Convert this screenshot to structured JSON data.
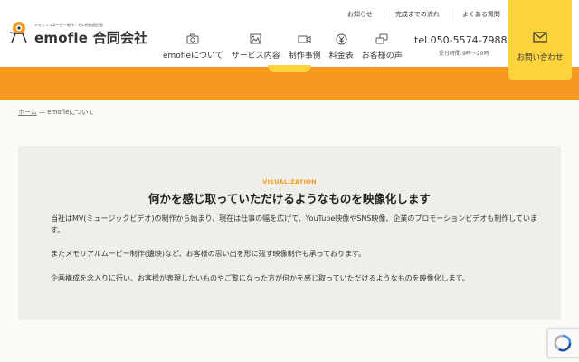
{
  "header": {
    "logo_tagline": "メモリアルムービー制作｜その他動画企画",
    "logo_name": "emofle 合同会社",
    "top_links": [
      "お知らせ",
      "完成までの流れ",
      "よくある質問"
    ],
    "main_nav": [
      {
        "label": "emofleについて",
        "icon": "camera-icon"
      },
      {
        "label": "サービス内容",
        "icon": "image-icon"
      },
      {
        "label": "制作事例",
        "icon": "video-icon"
      },
      {
        "label": "料金表",
        "icon": "yen-icon"
      },
      {
        "label": "お客様の声",
        "icon": "chat-icon"
      }
    ],
    "tel": "tel.050-5574-7988",
    "hours": "受付時間:9時〜20時",
    "contact_label": "お問い合わせ",
    "contact_icon": "mail-icon"
  },
  "breadcrumb": {
    "home": "ホーム",
    "separator": "—",
    "current": "emofleについて"
  },
  "section": {
    "kicker": "VISUALIZATION",
    "title": "何かを感じ取っていただけるようなものを映像化します",
    "paragraphs": [
      "当社はMV(ミュージックビデオ)の制作から始まり、現在は仕事の幅を広げて、YouTube映像やSNS映像、企業のプロモーションビデオも制作しています。",
      "またメモリアルムービー制作(遺映)など、お客様の思い出を形に残す映像制作も承っております。",
      "企画構成を念入りに行い、お客様が表現したいものやご覧になった方が何かを感じ取っていただけるようなものを映像化します。"
    ]
  },
  "colors": {
    "accent_orange": "#f59a1e",
    "accent_yellow": "#fbd33c",
    "panel_bg": "#efeee9"
  }
}
